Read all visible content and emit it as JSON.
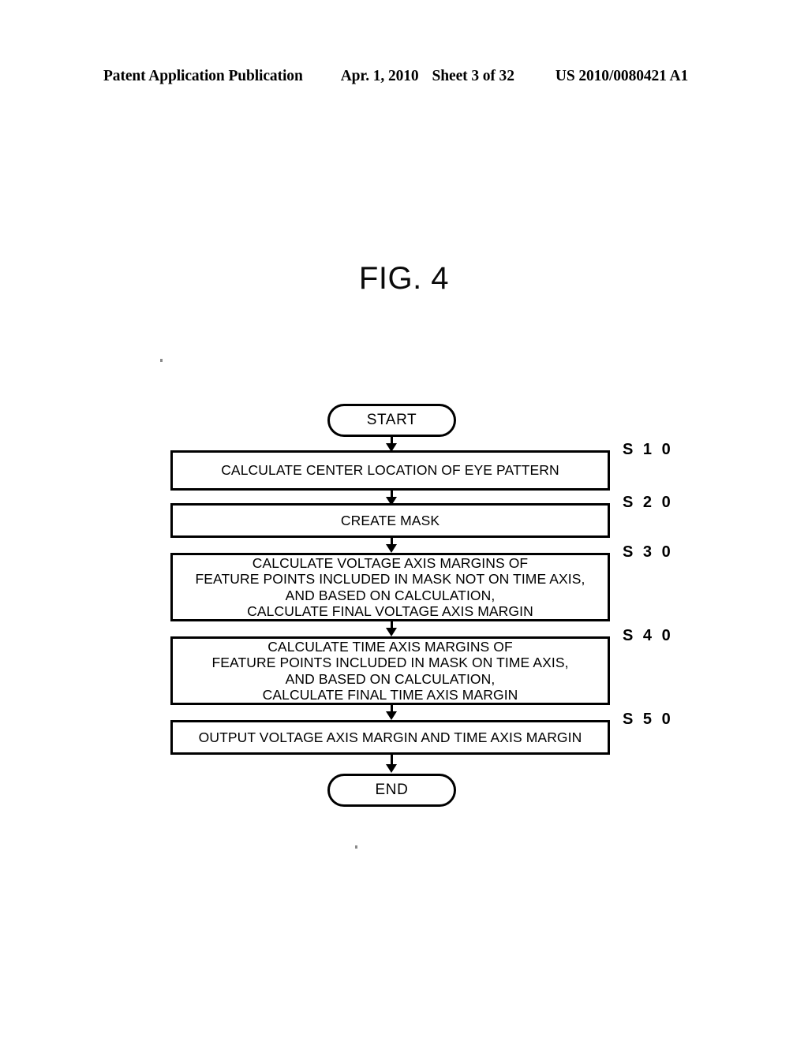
{
  "header": {
    "publication": "Patent Application Publication",
    "date": "Apr. 1, 2010",
    "sheet": "Sheet 3 of 32",
    "patent_number": "US 2010/0080421 A1"
  },
  "figure": {
    "title": "FIG. 4"
  },
  "flowchart": {
    "type": "flowchart",
    "orientation": "top-to-bottom",
    "nodes": [
      {
        "id": "start",
        "shape": "terminal",
        "label": "START",
        "step": null
      },
      {
        "id": "s10",
        "shape": "process",
        "label": "CALCULATE CENTER LOCATION OF EYE PATTERN",
        "step": "S 1 0"
      },
      {
        "id": "s20",
        "shape": "process",
        "label": "CREATE MASK",
        "step": "S 2 0"
      },
      {
        "id": "s30",
        "shape": "process",
        "label": "CALCULATE VOLTAGE AXIS MARGINS OF\nFEATURE POINTS INCLUDED IN MASK NOT ON TIME AXIS,\nAND BASED ON CALCULATION,\nCALCULATE FINAL VOLTAGE AXIS MARGIN",
        "step": "S 3 0"
      },
      {
        "id": "s40",
        "shape": "process",
        "label": "CALCULATE TIME AXIS MARGINS OF\nFEATURE POINTS INCLUDED IN MASK ON TIME AXIS,\nAND BASED ON CALCULATION,\nCALCULATE FINAL TIME AXIS MARGIN",
        "step": "S 4 0"
      },
      {
        "id": "s50",
        "shape": "process",
        "label": "OUTPUT VOLTAGE AXIS MARGIN AND TIME AXIS MARGIN",
        "step": "S 5 0"
      },
      {
        "id": "end",
        "shape": "terminal",
        "label": "END",
        "step": null
      }
    ],
    "edges": [
      {
        "from": "start",
        "to": "s10"
      },
      {
        "from": "s10",
        "to": "s20"
      },
      {
        "from": "s20",
        "to": "s30"
      },
      {
        "from": "s30",
        "to": "s40"
      },
      {
        "from": "s40",
        "to": "s50"
      },
      {
        "from": "s50",
        "to": "end"
      }
    ]
  },
  "colors": {
    "ink": "#000000",
    "paper": "#ffffff"
  }
}
